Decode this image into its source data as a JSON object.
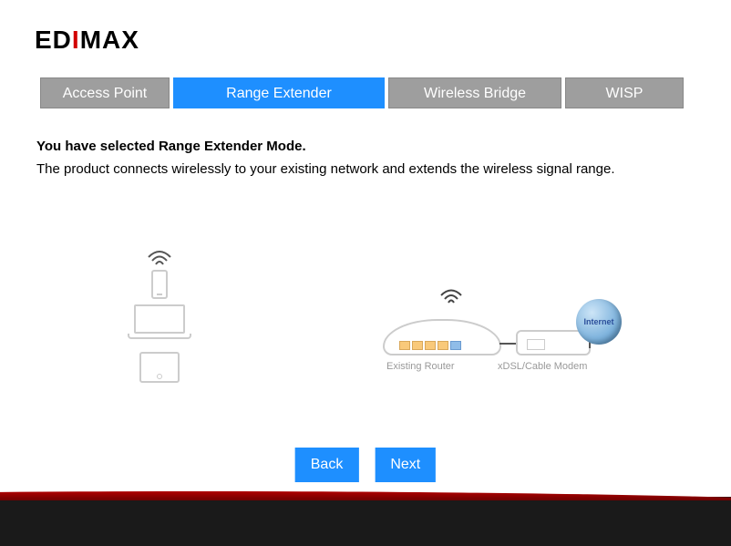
{
  "brand": {
    "name": "EDIMAX"
  },
  "tabs": [
    {
      "label": "Access Point",
      "active": false
    },
    {
      "label": "Range Extender",
      "active": true
    },
    {
      "label": "Wireless Bridge",
      "active": false
    },
    {
      "label": "WISP",
      "active": false
    }
  ],
  "description": {
    "title": "You have selected Range Extender Mode.",
    "body": "The product connects wirelessly to your existing network and extends the wireless signal range."
  },
  "diagram": {
    "router_label": "Existing Router",
    "modem_label": "xDSL/Cable Modem",
    "globe_label": "Internet"
  },
  "buttons": {
    "back": "Back",
    "next": "Next"
  }
}
